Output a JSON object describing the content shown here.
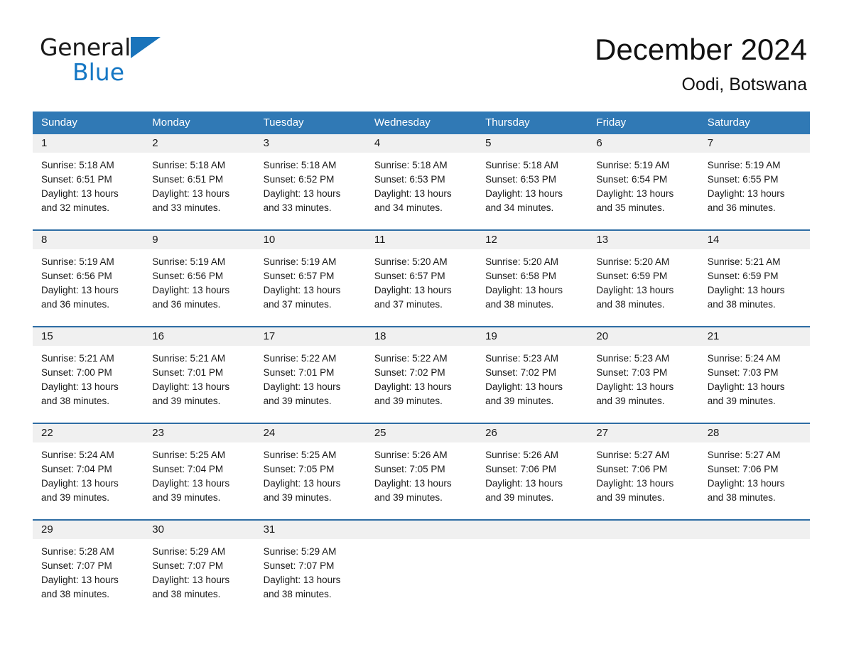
{
  "brand": {
    "name_part1": "General",
    "name_part2": "Blue",
    "logo_icon": "triangle-logo-icon",
    "accent_color": "#1577c4"
  },
  "header": {
    "title": "December 2024",
    "location": "Oodi, Botswana"
  },
  "calendar": {
    "header_background": "#3079b5",
    "row_divider_color": "#2e6da4",
    "date_band_background": "#f0f0f0",
    "weekdays": [
      "Sunday",
      "Monday",
      "Tuesday",
      "Wednesday",
      "Thursday",
      "Friday",
      "Saturday"
    ],
    "weeks": [
      [
        {
          "date": "1",
          "sunrise": "Sunrise: 5:18 AM",
          "sunset": "Sunset: 6:51 PM",
          "daylight_line1": "Daylight: 13 hours",
          "daylight_line2": "and 32 minutes."
        },
        {
          "date": "2",
          "sunrise": "Sunrise: 5:18 AM",
          "sunset": "Sunset: 6:51 PM",
          "daylight_line1": "Daylight: 13 hours",
          "daylight_line2": "and 33 minutes."
        },
        {
          "date": "3",
          "sunrise": "Sunrise: 5:18 AM",
          "sunset": "Sunset: 6:52 PM",
          "daylight_line1": "Daylight: 13 hours",
          "daylight_line2": "and 33 minutes."
        },
        {
          "date": "4",
          "sunrise": "Sunrise: 5:18 AM",
          "sunset": "Sunset: 6:53 PM",
          "daylight_line1": "Daylight: 13 hours",
          "daylight_line2": "and 34 minutes."
        },
        {
          "date": "5",
          "sunrise": "Sunrise: 5:18 AM",
          "sunset": "Sunset: 6:53 PM",
          "daylight_line1": "Daylight: 13 hours",
          "daylight_line2": "and 34 minutes."
        },
        {
          "date": "6",
          "sunrise": "Sunrise: 5:19 AM",
          "sunset": "Sunset: 6:54 PM",
          "daylight_line1": "Daylight: 13 hours",
          "daylight_line2": "and 35 minutes."
        },
        {
          "date": "7",
          "sunrise": "Sunrise: 5:19 AM",
          "sunset": "Sunset: 6:55 PM",
          "daylight_line1": "Daylight: 13 hours",
          "daylight_line2": "and 36 minutes."
        }
      ],
      [
        {
          "date": "8",
          "sunrise": "Sunrise: 5:19 AM",
          "sunset": "Sunset: 6:56 PM",
          "daylight_line1": "Daylight: 13 hours",
          "daylight_line2": "and 36 minutes."
        },
        {
          "date": "9",
          "sunrise": "Sunrise: 5:19 AM",
          "sunset": "Sunset: 6:56 PM",
          "daylight_line1": "Daylight: 13 hours",
          "daylight_line2": "and 36 minutes."
        },
        {
          "date": "10",
          "sunrise": "Sunrise: 5:19 AM",
          "sunset": "Sunset: 6:57 PM",
          "daylight_line1": "Daylight: 13 hours",
          "daylight_line2": "and 37 minutes."
        },
        {
          "date": "11",
          "sunrise": "Sunrise: 5:20 AM",
          "sunset": "Sunset: 6:57 PM",
          "daylight_line1": "Daylight: 13 hours",
          "daylight_line2": "and 37 minutes."
        },
        {
          "date": "12",
          "sunrise": "Sunrise: 5:20 AM",
          "sunset": "Sunset: 6:58 PM",
          "daylight_line1": "Daylight: 13 hours",
          "daylight_line2": "and 38 minutes."
        },
        {
          "date": "13",
          "sunrise": "Sunrise: 5:20 AM",
          "sunset": "Sunset: 6:59 PM",
          "daylight_line1": "Daylight: 13 hours",
          "daylight_line2": "and 38 minutes."
        },
        {
          "date": "14",
          "sunrise": "Sunrise: 5:21 AM",
          "sunset": "Sunset: 6:59 PM",
          "daylight_line1": "Daylight: 13 hours",
          "daylight_line2": "and 38 minutes."
        }
      ],
      [
        {
          "date": "15",
          "sunrise": "Sunrise: 5:21 AM",
          "sunset": "Sunset: 7:00 PM",
          "daylight_line1": "Daylight: 13 hours",
          "daylight_line2": "and 38 minutes."
        },
        {
          "date": "16",
          "sunrise": "Sunrise: 5:21 AM",
          "sunset": "Sunset: 7:01 PM",
          "daylight_line1": "Daylight: 13 hours",
          "daylight_line2": "and 39 minutes."
        },
        {
          "date": "17",
          "sunrise": "Sunrise: 5:22 AM",
          "sunset": "Sunset: 7:01 PM",
          "daylight_line1": "Daylight: 13 hours",
          "daylight_line2": "and 39 minutes."
        },
        {
          "date": "18",
          "sunrise": "Sunrise: 5:22 AM",
          "sunset": "Sunset: 7:02 PM",
          "daylight_line1": "Daylight: 13 hours",
          "daylight_line2": "and 39 minutes."
        },
        {
          "date": "19",
          "sunrise": "Sunrise: 5:23 AM",
          "sunset": "Sunset: 7:02 PM",
          "daylight_line1": "Daylight: 13 hours",
          "daylight_line2": "and 39 minutes."
        },
        {
          "date": "20",
          "sunrise": "Sunrise: 5:23 AM",
          "sunset": "Sunset: 7:03 PM",
          "daylight_line1": "Daylight: 13 hours",
          "daylight_line2": "and 39 minutes."
        },
        {
          "date": "21",
          "sunrise": "Sunrise: 5:24 AM",
          "sunset": "Sunset: 7:03 PM",
          "daylight_line1": "Daylight: 13 hours",
          "daylight_line2": "and 39 minutes."
        }
      ],
      [
        {
          "date": "22",
          "sunrise": "Sunrise: 5:24 AM",
          "sunset": "Sunset: 7:04 PM",
          "daylight_line1": "Daylight: 13 hours",
          "daylight_line2": "and 39 minutes."
        },
        {
          "date": "23",
          "sunrise": "Sunrise: 5:25 AM",
          "sunset": "Sunset: 7:04 PM",
          "daylight_line1": "Daylight: 13 hours",
          "daylight_line2": "and 39 minutes."
        },
        {
          "date": "24",
          "sunrise": "Sunrise: 5:25 AM",
          "sunset": "Sunset: 7:05 PM",
          "daylight_line1": "Daylight: 13 hours",
          "daylight_line2": "and 39 minutes."
        },
        {
          "date": "25",
          "sunrise": "Sunrise: 5:26 AM",
          "sunset": "Sunset: 7:05 PM",
          "daylight_line1": "Daylight: 13 hours",
          "daylight_line2": "and 39 minutes."
        },
        {
          "date": "26",
          "sunrise": "Sunrise: 5:26 AM",
          "sunset": "Sunset: 7:06 PM",
          "daylight_line1": "Daylight: 13 hours",
          "daylight_line2": "and 39 minutes."
        },
        {
          "date": "27",
          "sunrise": "Sunrise: 5:27 AM",
          "sunset": "Sunset: 7:06 PM",
          "daylight_line1": "Daylight: 13 hours",
          "daylight_line2": "and 39 minutes."
        },
        {
          "date": "28",
          "sunrise": "Sunrise: 5:27 AM",
          "sunset": "Sunset: 7:06 PM",
          "daylight_line1": "Daylight: 13 hours",
          "daylight_line2": "and 38 minutes."
        }
      ],
      [
        {
          "date": "29",
          "sunrise": "Sunrise: 5:28 AM",
          "sunset": "Sunset: 7:07 PM",
          "daylight_line1": "Daylight: 13 hours",
          "daylight_line2": "and 38 minutes."
        },
        {
          "date": "30",
          "sunrise": "Sunrise: 5:29 AM",
          "sunset": "Sunset: 7:07 PM",
          "daylight_line1": "Daylight: 13 hours",
          "daylight_line2": "and 38 minutes."
        },
        {
          "date": "31",
          "sunrise": "Sunrise: 5:29 AM",
          "sunset": "Sunset: 7:07 PM",
          "daylight_line1": "Daylight: 13 hours",
          "daylight_line2": "and 38 minutes."
        },
        {
          "date": "",
          "sunrise": "",
          "sunset": "",
          "daylight_line1": "",
          "daylight_line2": ""
        },
        {
          "date": "",
          "sunrise": "",
          "sunset": "",
          "daylight_line1": "",
          "daylight_line2": ""
        },
        {
          "date": "",
          "sunrise": "",
          "sunset": "",
          "daylight_line1": "",
          "daylight_line2": ""
        },
        {
          "date": "",
          "sunrise": "",
          "sunset": "",
          "daylight_line1": "",
          "daylight_line2": ""
        }
      ]
    ]
  }
}
